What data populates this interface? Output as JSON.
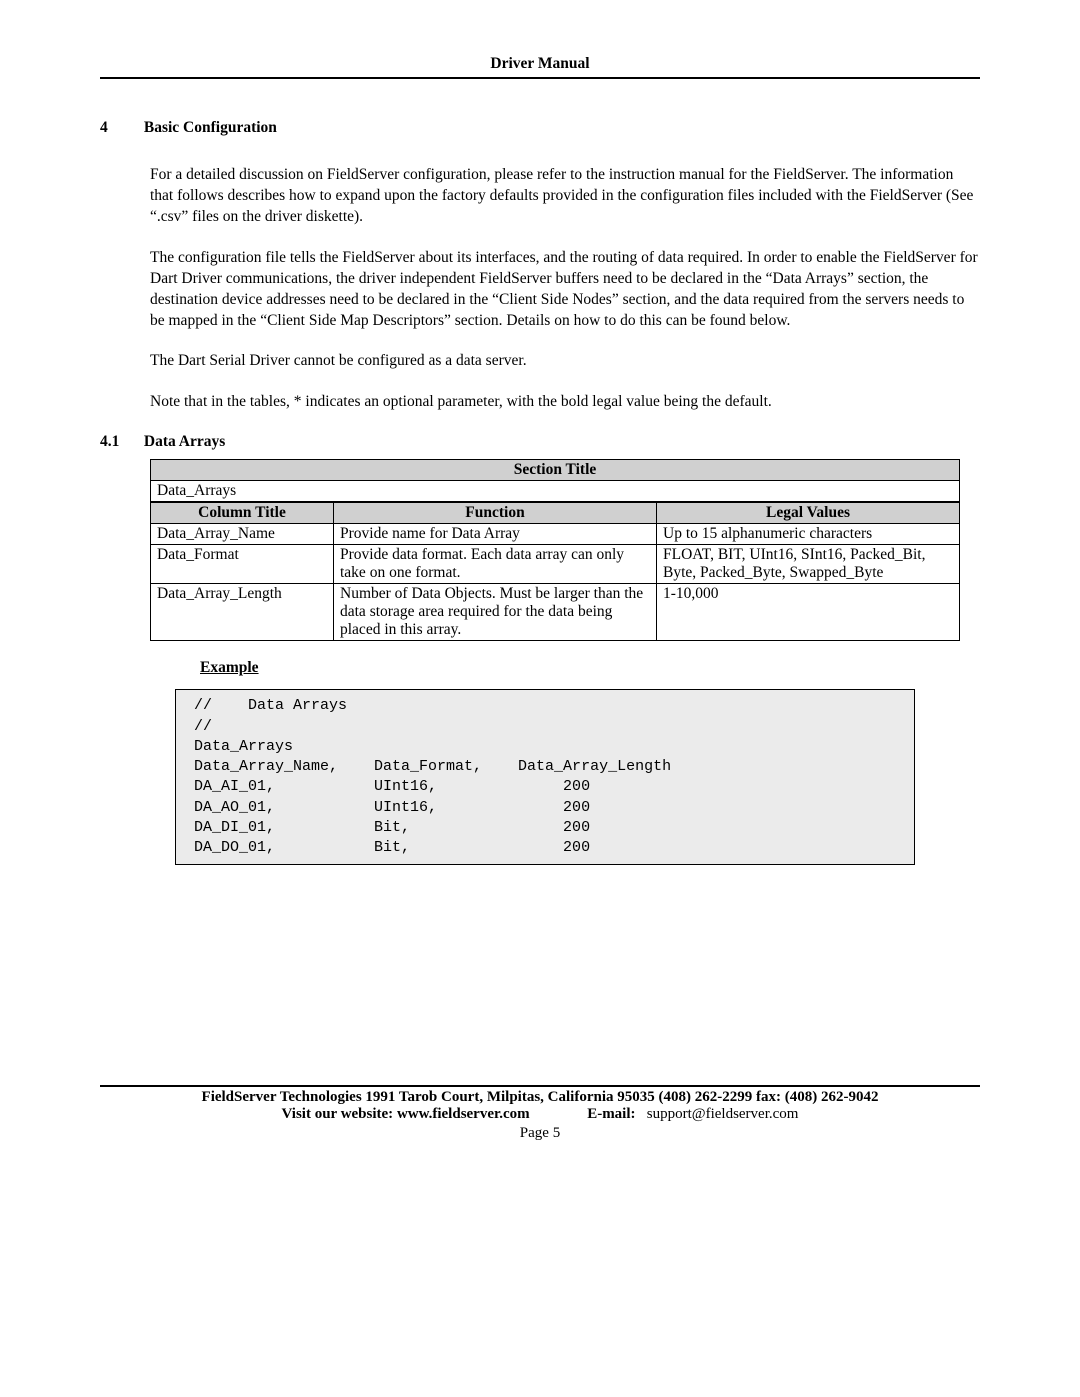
{
  "header": {
    "title": "Driver Manual"
  },
  "section": {
    "number": "4",
    "title": "Basic Configuration",
    "para1": "For a detailed discussion on FieldServer configuration, please refer to the instruction manual for the FieldServer. The information that follows describes how to expand upon the factory defaults provided in the configuration files included with the FieldServer (See “.csv” files on the driver diskette).",
    "para2": "The configuration file tells the FieldServer about its interfaces, and the routing of data required. In order to enable the FieldServer for Dart Driver communications, the driver independent FieldServer buffers need to be declared in the “Data Arrays” section, the destination device addresses need to be declared in the “Client Side Nodes” section, and the data required from the servers needs to be mapped in the “Client Side Map Descriptors” section. Details on how to do this can be found below.",
    "para3": "The Dart Serial Driver cannot be configured as a data server.",
    "para4": "Note that in the tables,  * indicates an optional parameter, with the bold legal value being the default."
  },
  "subsection": {
    "number": "4.1",
    "title": "Data Arrays"
  },
  "table": {
    "section_title_header": "Section Title",
    "section_title_value": "Data_Arrays",
    "headers": {
      "col1": "Column Title",
      "col2": "Function",
      "col3": "Legal Values"
    },
    "rows": [
      {
        "c1": "Data_Array_Name",
        "c2": "Provide name for Data Array",
        "c3": "Up to 15 alphanumeric characters"
      },
      {
        "c1": "Data_Format",
        "c2": "Provide data format. Each data array can only take on one format.",
        "c3": "FLOAT, BIT, UInt16, SInt16, Packed_Bit, Byte, Packed_Byte, Swapped_Byte"
      },
      {
        "c1": "Data_Array_Length",
        "c2": "Number of Data Objects. Must be larger than the data storage area required for the data being placed in this array.",
        "c3": "1-10,000"
      }
    ]
  },
  "example": {
    "label": "Example",
    "code": "//    Data Arrays\n//\nData_Arrays\nData_Array_Name,    Data_Format,    Data_Array_Length\nDA_AI_01,           UInt16,              200\nDA_AO_01,           UInt16,              200\nDA_DI_01,           Bit,                 200\nDA_DO_01,           Bit,                 200"
  },
  "footer": {
    "line1": "FieldServer Technologies 1991 Tarob Court, Milpitas, California 95035 (408) 262-2299 fax: (408) 262-9042",
    "website_label": "Visit our website: ",
    "website": "www.fieldserver.com",
    "email_label": "E-mail:",
    "email": "support@fieldserver.com",
    "page": "Page 5"
  }
}
